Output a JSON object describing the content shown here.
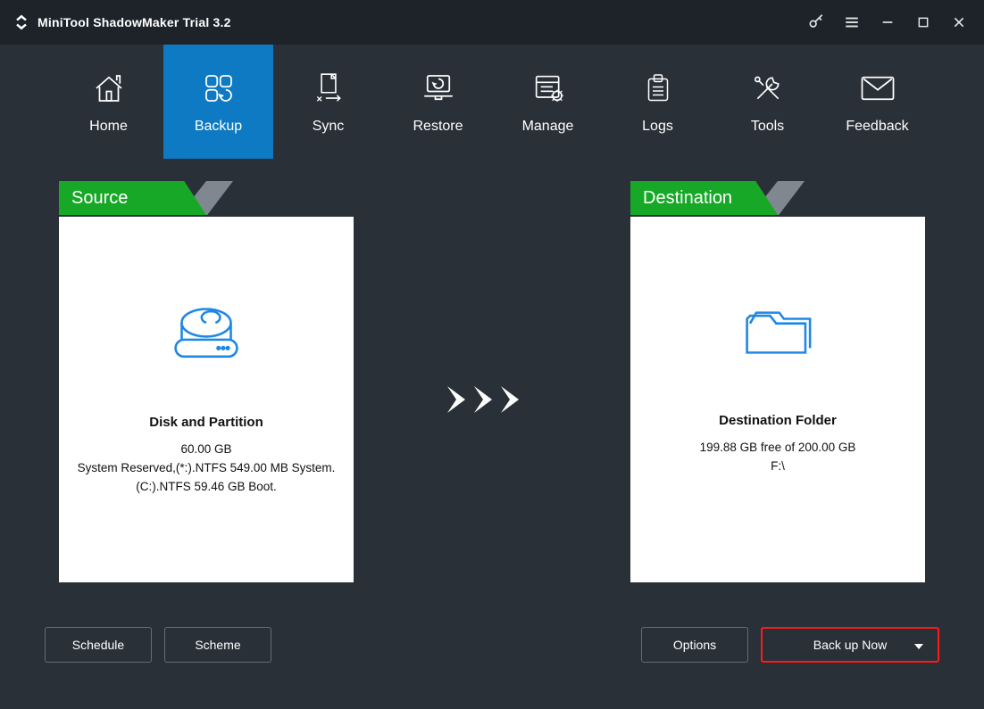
{
  "app": {
    "title": "MiniTool ShadowMaker Trial 3.2"
  },
  "nav": {
    "items": [
      {
        "label": "Home"
      },
      {
        "label": "Backup"
      },
      {
        "label": "Sync"
      },
      {
        "label": "Restore"
      },
      {
        "label": "Manage"
      },
      {
        "label": "Logs"
      },
      {
        "label": "Tools"
      },
      {
        "label": "Feedback"
      }
    ]
  },
  "source": {
    "tab": "Source",
    "title": "Disk and Partition",
    "size": "60.00 GB",
    "line1": "System Reserved,(*:).NTFS 549.00 MB System.",
    "line2": "(C:).NTFS 59.46 GB Boot."
  },
  "destination": {
    "tab": "Destination",
    "title": "Destination Folder",
    "free": "199.88 GB free of 200.00 GB",
    "path": "F:\\"
  },
  "buttons": {
    "schedule": "Schedule",
    "scheme": "Scheme",
    "options": "Options",
    "backup_now": "Back up Now"
  }
}
